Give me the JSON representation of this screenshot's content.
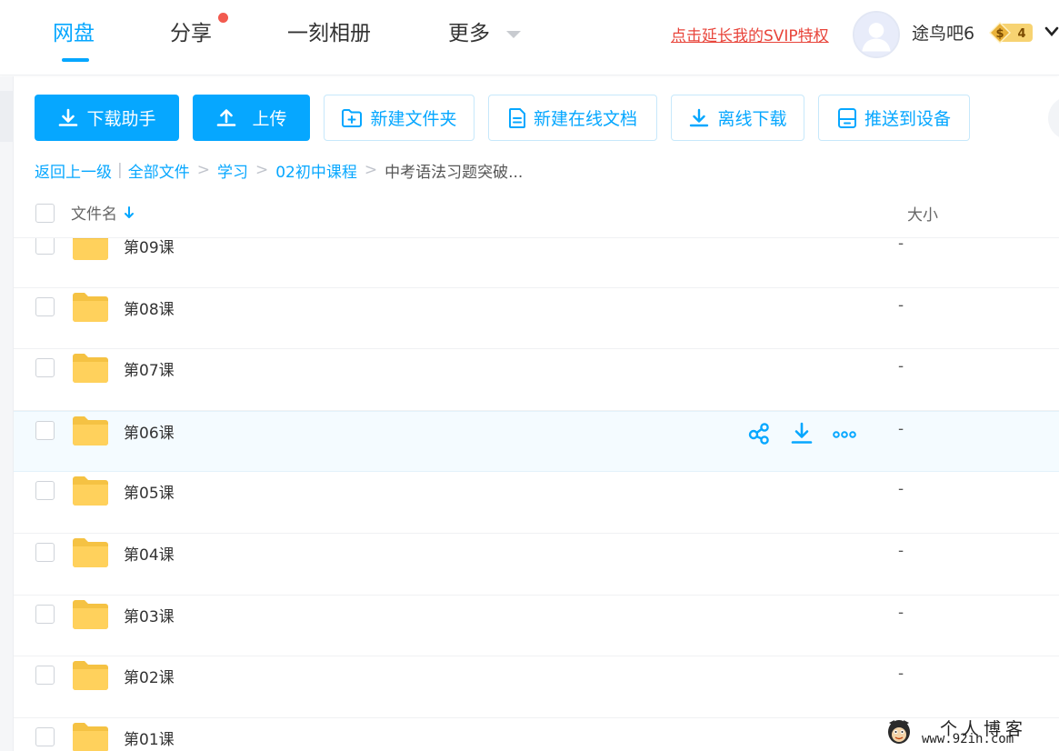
{
  "nav": {
    "tabs": [
      {
        "label": "网盘",
        "active": true
      },
      {
        "label": "分享",
        "has_badge": true
      },
      {
        "label": "一刻相册"
      },
      {
        "label": "更多"
      }
    ],
    "svip_link": "点击延长我的SVIP特权",
    "username": "途鸟吧6",
    "vip_badge_level": "4",
    "vip_badge_symbol": "$"
  },
  "toolbar": {
    "download_helper": "下载助手",
    "upload": "上传",
    "new_folder": "新建文件夹",
    "new_online_doc": "新建在线文档",
    "offline_download": "离线下载",
    "push_to_device": "推送到设备"
  },
  "breadcrumb": {
    "back": "返回上一级",
    "separator": "|",
    "items": [
      "全部文件",
      "学习",
      "02初中课程"
    ],
    "current": "中考语法习题突破..."
  },
  "table": {
    "col_name": "文件名",
    "col_size": "大小",
    "rows": [
      {
        "name": "第09课",
        "size": "-"
      },
      {
        "name": "第08课",
        "size": "-"
      },
      {
        "name": "第07课",
        "size": "-"
      },
      {
        "name": "第06课",
        "size": "-",
        "hover": true
      },
      {
        "name": "第05课",
        "size": "-"
      },
      {
        "name": "第04课",
        "size": "-"
      },
      {
        "name": "第03课",
        "size": "-"
      },
      {
        "name": "第02课",
        "size": "-"
      },
      {
        "name": "第01课",
        "size": "-"
      }
    ]
  },
  "watermark": {
    "title": "个人博客",
    "url": "www.92in.com"
  },
  "colors": {
    "accent": "#06a7ff",
    "folder": "#ffd15c",
    "svip_red": "#e8443a",
    "badge_dot": "#f25a4f"
  },
  "icons": {
    "row_actions": [
      "share-icon",
      "download-icon",
      "more-icon"
    ],
    "sort": "sort-arrow-down-icon"
  }
}
